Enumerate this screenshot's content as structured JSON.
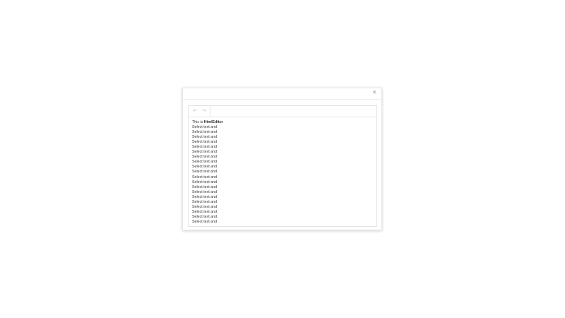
{
  "dialog": {
    "close_icon": "close-icon"
  },
  "toolbar": {
    "undo_icon": "undo-icon",
    "redo_icon": "redo-icon"
  },
  "editor": {
    "intro_prefix": "This is ",
    "intro_bold": "HtmlEditor",
    "lines": [
      "Select text and",
      "Select text and",
      "Select text and",
      "Select text and",
      "Select text and",
      "Select text and",
      "Select text and",
      "Select text and",
      "Select text and",
      "Select text and",
      "Select text and",
      "Select text and",
      "Select text and",
      "Select text and",
      "Select text and",
      "Select text and",
      "Select text and",
      "Select text and",
      "Select text and",
      "Select text and"
    ]
  }
}
